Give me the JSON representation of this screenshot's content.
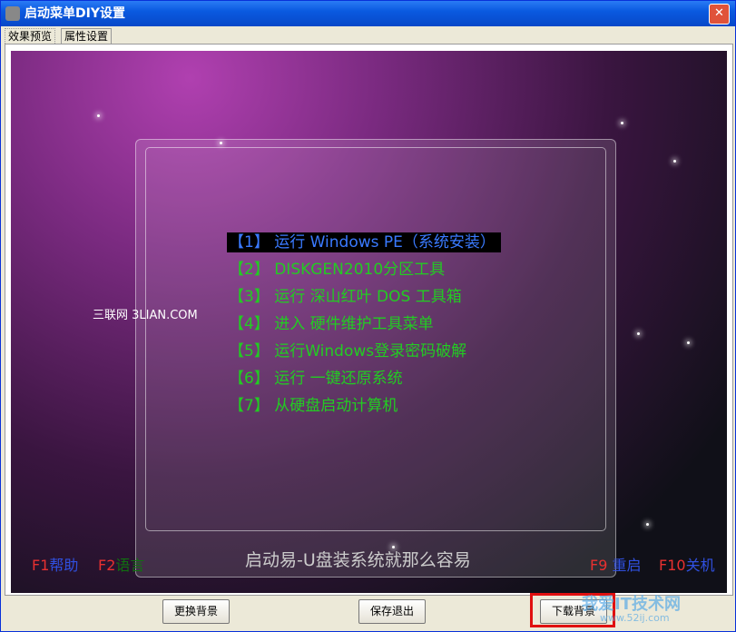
{
  "window": {
    "title": "启动菜单DIY设置",
    "close": "✕"
  },
  "tabs": [
    {
      "label": "效果预览"
    },
    {
      "label": "属性设置"
    }
  ],
  "preview": {
    "menu": [
      {
        "label": "【1】 运行 Windows PE（系统安装）",
        "selected": true
      },
      {
        "label": "【2】 DISKGEN2010分区工具"
      },
      {
        "label": "【3】 运行 深山红叶 DOS 工具箱"
      },
      {
        "label": "【4】 进入 硬件维护工具菜单"
      },
      {
        "label": "【5】 运行Windows登录密码破解"
      },
      {
        "label": "【6】 运行 一键还原系统"
      },
      {
        "label": "【7】 从硬盘启动计算机"
      }
    ],
    "site_logo": "三联网 3LIAN.COM",
    "slogan": "启动易-U盘装系统就那么容易",
    "keys": {
      "f1": "F1",
      "f1_label": "帮助",
      "f2": "F2",
      "f2_label": "语言",
      "f9": "F9",
      "f9_label": "重启",
      "f10": "F10",
      "f10_label": "关机"
    }
  },
  "buttons": {
    "change_bg": "更换背景",
    "save_exit": "保存退出",
    "download_bg": "下载背景"
  },
  "watermark": {
    "text": "我爱IT技术网",
    "url": "www.52ij.com"
  }
}
